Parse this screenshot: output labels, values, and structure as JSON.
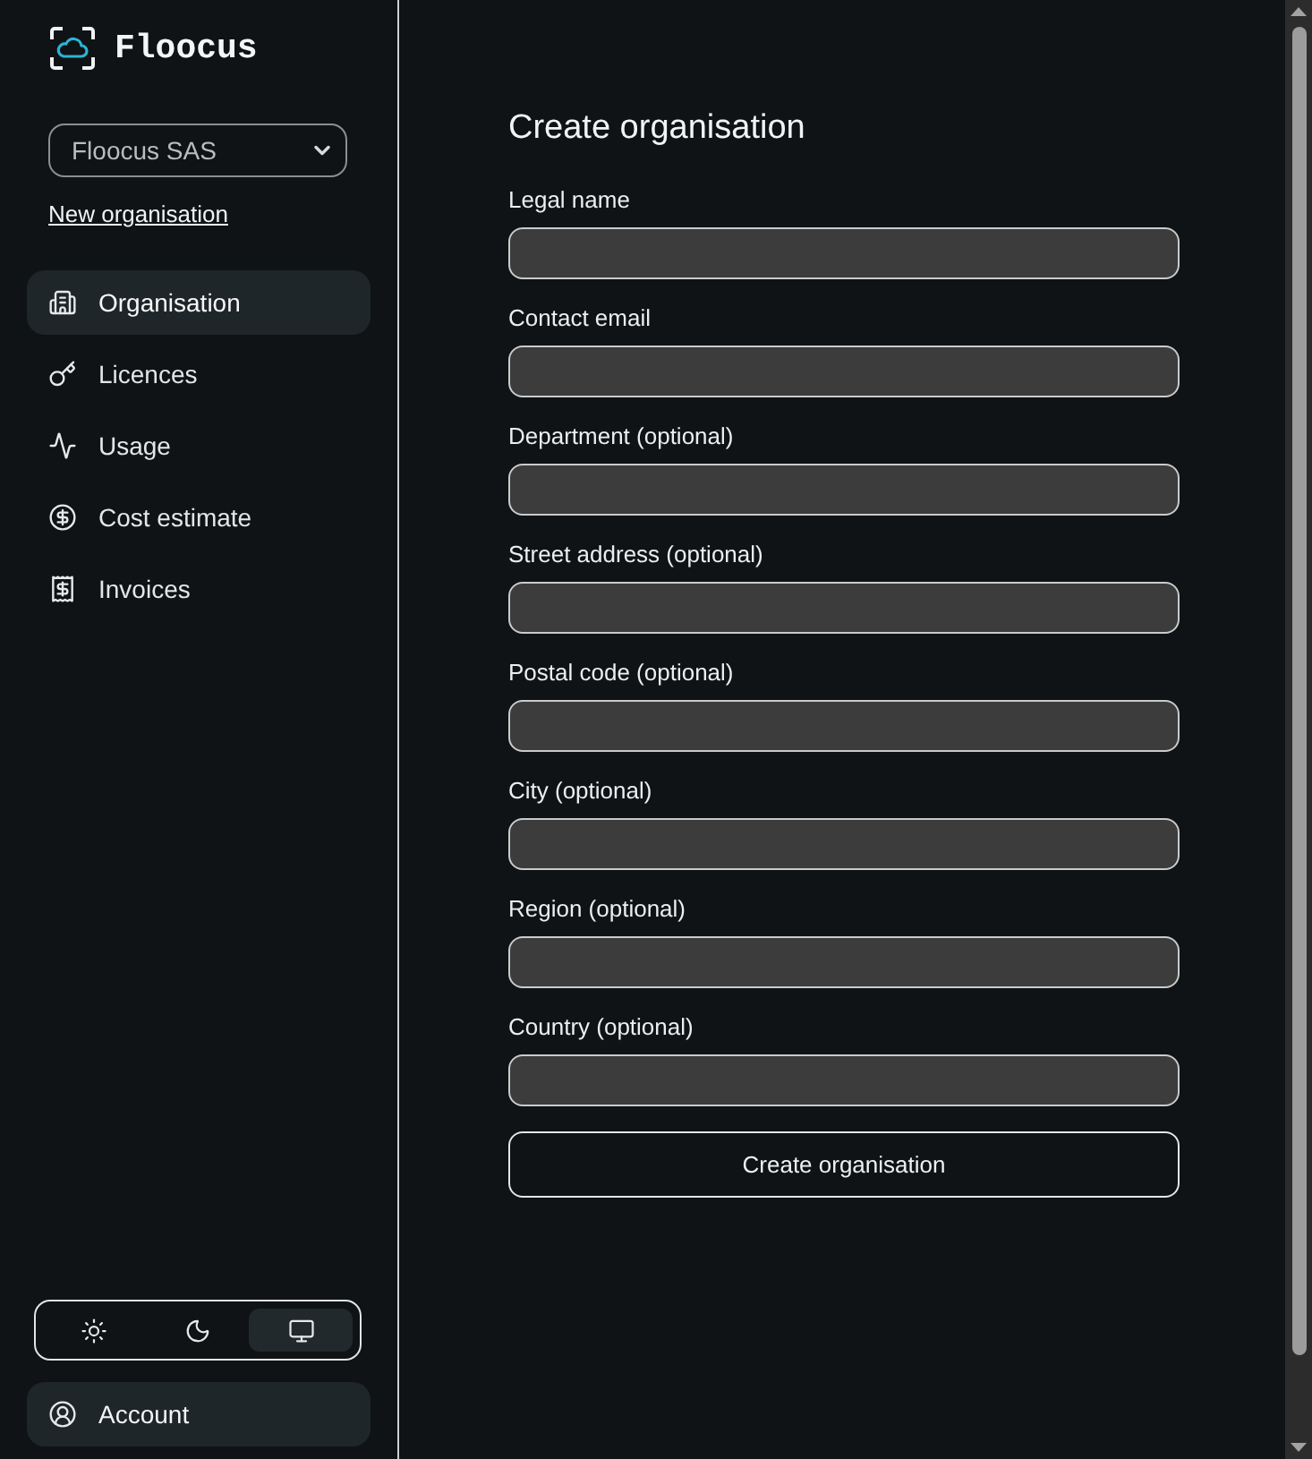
{
  "brand": {
    "name": "Floocus"
  },
  "org_select": {
    "value": "Floocus SAS"
  },
  "new_org_link": "New organisation",
  "nav": [
    {
      "label": "Organisation",
      "selected": true
    },
    {
      "label": "Licences",
      "selected": false
    },
    {
      "label": "Usage",
      "selected": false
    },
    {
      "label": "Cost estimate",
      "selected": false
    },
    {
      "label": "Invoices",
      "selected": false
    }
  ],
  "theme_toggle": [
    {
      "selected": false
    },
    {
      "selected": false
    },
    {
      "selected": true
    }
  ],
  "account": {
    "label": "Account"
  },
  "form": {
    "title": "Create organisation",
    "fields": [
      {
        "label": "Legal name"
      },
      {
        "label": "Contact email"
      },
      {
        "label": "Department (optional)"
      },
      {
        "label": "Street address (optional)"
      },
      {
        "label": "Postal code (optional)"
      },
      {
        "label": "City (optional)"
      },
      {
        "label": "Region (optional)"
      },
      {
        "label": "Country (optional)"
      }
    ],
    "submit": "Create organisation"
  }
}
